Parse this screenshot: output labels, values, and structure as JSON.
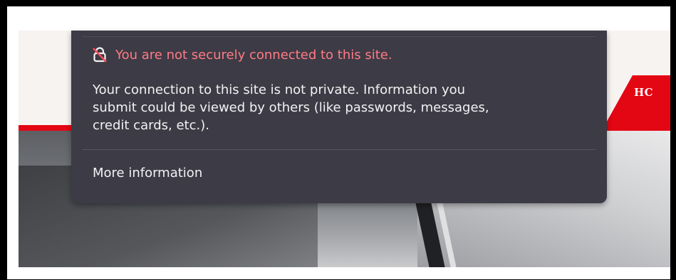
{
  "site": {
    "nav_label": "HC",
    "brand_color": "#e30613"
  },
  "identity_popup": {
    "warning_icon": "broken-lock-icon",
    "warning_text": "You are not securely connected to this site.",
    "warning_color": "#ff7b86",
    "description_lines": [
      "Your connection to this site is not private. Information you",
      "submit could be viewed by others (like passwords, messages,",
      "credit cards, etc.)."
    ],
    "more_info_label": "More information"
  }
}
